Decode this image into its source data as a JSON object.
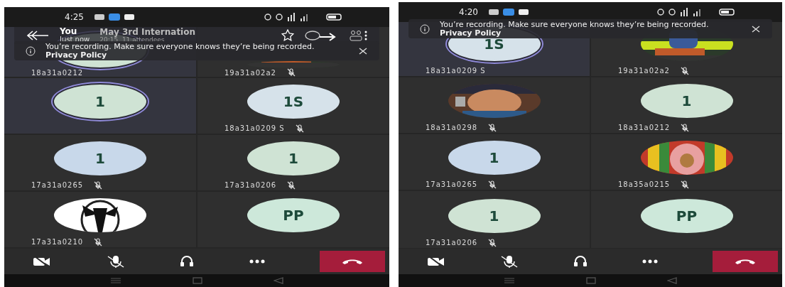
{
  "phones": [
    {
      "status_bar": {
        "time": "4:25"
      },
      "header": {
        "self_label": "You",
        "self_time": "Just now",
        "title": "May 3rd Internation",
        "subtitle": "20:15  11 attendees"
      },
      "banner": {
        "text": "You’re recording. Make sure everyone knows they’re being recorded. **Privacy Policy**"
      },
      "tiles": [
        {
          "kind": "initials",
          "color": "#cfe3d4",
          "name": "18a31a0212",
          "muted": false,
          "speaking": true
        },
        {
          "kind": "picture",
          "name": "19a31a02a2",
          "muted": true,
          "speaking": false
        },
        {
          "kind": "initials",
          "initials": "1",
          "color": "#cfe3d4",
          "speaking": true,
          "muted": false
        },
        {
          "kind": "initials",
          "initials": "1S",
          "color": "#d6e2ea",
          "name": "18a31a0209 S",
          "muted": true,
          "speaking": false
        },
        {
          "kind": "initials",
          "initials": "1",
          "color": "#c8d8ea",
          "name": "17a31a0265",
          "muted": true,
          "speaking": false
        },
        {
          "kind": "initials",
          "initials": "1",
          "color": "#cfe3d4",
          "name": "17a31a0206",
          "muted": true,
          "speaking": false
        },
        {
          "kind": "picture",
          "name": "17a31a0210",
          "muted": true,
          "speaking": false
        },
        {
          "kind": "initials",
          "initials": "PP",
          "color": "#cde8da",
          "muted": false,
          "speaking": false
        }
      ]
    },
    {
      "status_bar": {
        "time": "4:20"
      },
      "banner": {
        "text": "You’re recording. Make sure everyone knows they’re being recorded. **Privacy Policy**"
      },
      "tiles": [
        {
          "kind": "initials",
          "initials": "1S",
          "color": "#d6e2ea",
          "name": "18a31a0209 S",
          "muted": false,
          "speaking": true
        },
        {
          "kind": "picture",
          "name": "19a31a02a2",
          "muted": true,
          "speaking": false
        },
        {
          "kind": "picture",
          "name": "18a31a0298",
          "muted": true,
          "speaking": false
        },
        {
          "kind": "initials",
          "initials": "1",
          "color": "#cfe3d4",
          "name": "18a31a0212",
          "muted": true,
          "speaking": false
        },
        {
          "kind": "initials",
          "initials": "1",
          "color": "#c8d8ea",
          "name": "17a31a0265",
          "muted": true,
          "speaking": false
        },
        {
          "kind": "picture",
          "name": "18a35a0215",
          "muted": true,
          "speaking": false
        },
        {
          "kind": "initials",
          "initials": "1",
          "color": "#cfe3d4",
          "name": "17a31a0206",
          "muted": true,
          "speaking": false
        },
        {
          "kind": "initials",
          "initials": "PP",
          "color": "#cde8da",
          "muted": false,
          "speaking": false
        }
      ]
    }
  ]
}
